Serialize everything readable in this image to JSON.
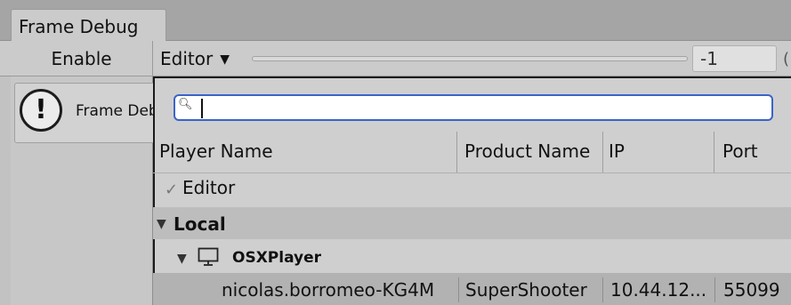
{
  "window": {
    "tab_label": "Frame Debug"
  },
  "toolbar": {
    "enable_label": "Enable",
    "target_dropdown_label": "Editor",
    "frame_value": "-1",
    "edge_char": "("
  },
  "helpbox": {
    "text": "Frame Debugger"
  },
  "popup": {
    "search_value": "",
    "columns": [
      "Player Name",
      "Product Name",
      "IP",
      "Port"
    ],
    "editor_item": {
      "label": "Editor",
      "checked": true
    },
    "local_group": {
      "label": "Local",
      "expanded": true
    },
    "osx_group": {
      "label": "OSXPlayer",
      "expanded": true
    },
    "player_row": {
      "player_name": "nicolas.borromeo-KG4M",
      "product_name": "SuperShooter",
      "ip": "10.44.12...",
      "port": "55099"
    }
  },
  "icons": {
    "warning": "warning-icon",
    "search": "search-icon",
    "check": "checkmark-icon",
    "monitor": "monitor-icon",
    "caret": "chevron-down-icon",
    "expand": "triangle-down-icon"
  },
  "colors": {
    "focus_border": "#3b63c9",
    "selected_row": "#b2b2b2"
  }
}
